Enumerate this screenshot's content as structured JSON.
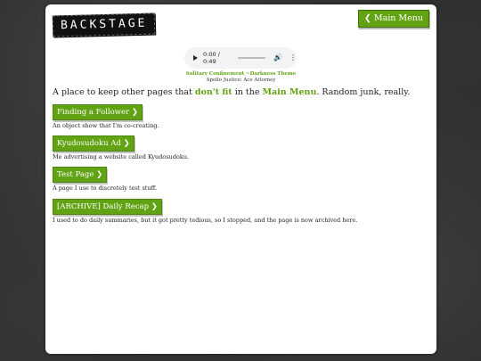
{
  "header": {
    "logo_text": "BACKSTAGE",
    "main_menu_label": "❮ Main Menu"
  },
  "audio": {
    "time": "0:00 / 0:49",
    "song_title": "Solitary Confinement ~Darkness Theme",
    "song_source": "Apollo Justice: Ace Attorney"
  },
  "intro": {
    "part1": "A place to keep other pages that ",
    "highlight1": "don't fit",
    "part2": " in the ",
    "highlight2": "Main Menu",
    "part3": ". Random junk, really."
  },
  "entries": [
    {
      "label": "Finding a Follower ❯",
      "description": "An object show that I'm co-creating."
    },
    {
      "label": "Kyudosudoku Ad ❯",
      "description": "Me advertising a website called Kyudosudoku."
    },
    {
      "label": "Test Page ❯",
      "description": "A page I use to discretely test stuff."
    },
    {
      "label": "[ARCHIVE] Daily Recap ❯",
      "description": "I used to do daily summaries, but it got pretty tedious, so I stopped, and the page is now archived here."
    }
  ],
  "colors": {
    "accent": "#62a314",
    "panel": "#ffffff",
    "background": "#2b2b2b"
  },
  "icons": [
    "play-icon",
    "volume-icon",
    "more-options-icon"
  ]
}
